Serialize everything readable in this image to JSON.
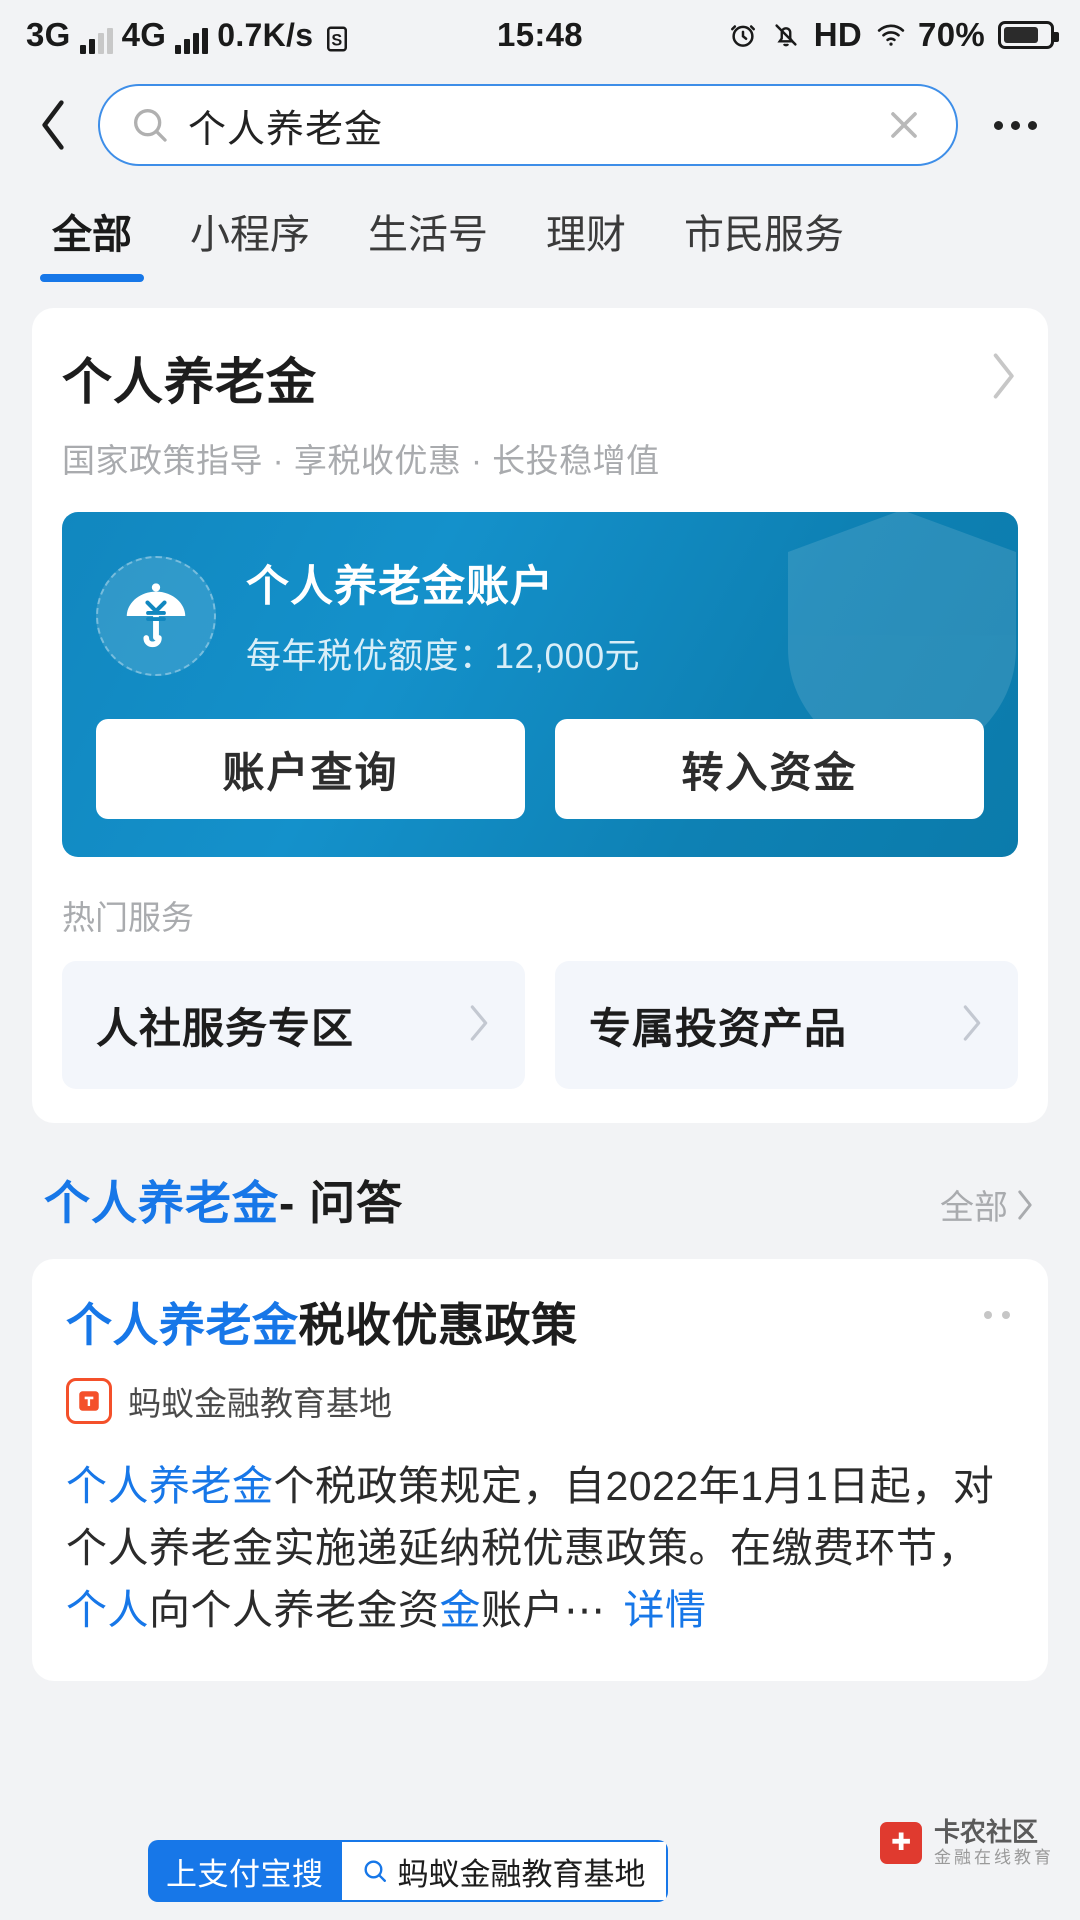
{
  "statusbar": {
    "net1": "3G",
    "net2": "4G",
    "speed": "0.7K/s",
    "app_icon": "screenshot-icon",
    "time": "15:48",
    "alarm_icon": "alarm-icon",
    "mute_icon": "bell-muted-icon",
    "hd": "HD",
    "wifi_icon": "wifi-icon",
    "battery": "70%"
  },
  "header": {
    "back_icon": "back-chevron-icon",
    "search_icon": "search-icon",
    "query": "个人养老金",
    "clear_icon": "close-icon",
    "more_icon": "more-dots-icon"
  },
  "tabs": [
    {
      "label": "全部",
      "active": true
    },
    {
      "label": "小程序",
      "active": false
    },
    {
      "label": "生活号",
      "active": false
    },
    {
      "label": "理财",
      "active": false
    },
    {
      "label": "市民服务",
      "active": false
    }
  ],
  "service_card": {
    "title": "个人养老金",
    "chevron_icon": "chevron-right-icon",
    "subtitle": "国家政策指导 · 享税收优惠 · 长投稳增值",
    "banner": {
      "icon": "umbrella-yuan-icon",
      "shield_icon": "shield-watermark-icon",
      "title": "个人养老金账户",
      "quota_label": "每年税优额度：",
      "quota_value": "12,000元",
      "quota_full": "每年税优额度：12,000元",
      "buttons": [
        {
          "label": "账户查询"
        },
        {
          "label": "转入资金"
        }
      ],
      "accent": "#1187bf"
    },
    "hot_label": "热门服务",
    "hot_items": [
      {
        "label": "人社服务专区",
        "chevron_icon": "chevron-right-icon"
      },
      {
        "label": "专属投资产品",
        "chevron_icon": "chevron-right-icon"
      }
    ]
  },
  "qa_section": {
    "highlight": "个人养老金",
    "rest": " - 问答",
    "all_label": "全部",
    "all_chevron_icon": "chevron-right-icon",
    "article": {
      "title_highlight": "个人养老金",
      "title_rest": "税收优惠政策",
      "more_icon": "more-dots-icon",
      "source_icon": "ant-education-icon",
      "source_name": "蚂蚁金融教育基地",
      "body_part1": "个人养老金",
      "body_part2": "个税政策规定，自2022年1月1日起，对个人养老金实施递延纳税优惠政策。在缴费环节，",
      "body_part3": "个人",
      "body_part4": "向个人养老金资",
      "body_part5": "金",
      "body_part6": "账户⋯",
      "detail_label": "详情"
    }
  },
  "bottom": {
    "search_prefix": "上支付宝搜",
    "search_icon": "search-icon",
    "search_term": "蚂蚁金融教育基地",
    "watermark_icon": "kanong-logo-icon",
    "watermark_title": "卡农社区",
    "watermark_sub": "金融在线教育",
    "accent": "#1777e8"
  },
  "colors": {
    "page_bg": "#f2f3f5",
    "accent_blue": "#1777e8",
    "banner_blue": "#1187bf",
    "muted_text": "#a9abae"
  }
}
